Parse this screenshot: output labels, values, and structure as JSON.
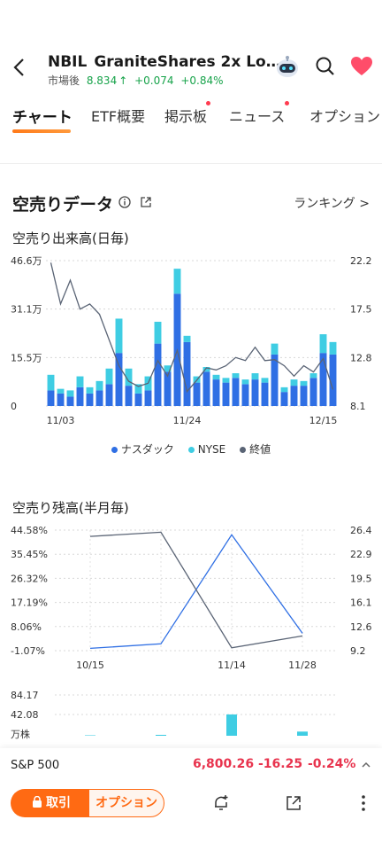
{
  "header": {
    "ticker": "NBIL",
    "name": "GraniteShares 2x Lo…",
    "session_label": "市場後",
    "price": "8.834",
    "arrow": "↑",
    "change": "+0.074",
    "change_pct": "+0.84%"
  },
  "tabs": [
    {
      "label": "チャート",
      "active": true
    },
    {
      "label": "ETF概要"
    },
    {
      "label": "掲示板",
      "badge": true
    },
    {
      "label": "ニュース",
      "badge": true
    },
    {
      "label": "オプション"
    }
  ],
  "short_section": {
    "title": "空売りデータ",
    "ranking": "ランキング",
    "ranking_chevron": ">"
  },
  "legend": [
    {
      "label": "ナスダック",
      "color": "#2f6fe4"
    },
    {
      "label": "NYSE",
      "color": "#3fcde3"
    },
    {
      "label": "終値",
      "color": "#5a6475"
    }
  ],
  "chart_data": [
    {
      "type": "bar",
      "title": "空売り出来高(日毎)",
      "y_ticks_left": [
        "46.6万",
        "31.1万",
        "15.5万",
        "0"
      ],
      "y_ticks_right": [
        "22.2",
        "17.5",
        "12.8",
        "8.1"
      ],
      "x_ticks": [
        "11/03",
        "11/24",
        "12/15"
      ],
      "ylim": [
        0,
        466000
      ],
      "y2lim": [
        8.1,
        22.2
      ],
      "series": [
        {
          "name": "ナスダック",
          "values": [
            50000,
            40000,
            30000,
            60000,
            40000,
            50000,
            70000,
            170000,
            65000,
            40000,
            50000,
            200000,
            110000,
            360000,
            205000,
            75000,
            110000,
            85000,
            75000,
            90000,
            70000,
            85000,
            75000,
            165000,
            45000,
            65000,
            65000,
            90000,
            170000,
            165000
          ]
        },
        {
          "name": "NYSE",
          "values": [
            50000,
            15000,
            20000,
            35000,
            20000,
            30000,
            50000,
            110000,
            55000,
            30000,
            45000,
            70000,
            20000,
            80000,
            20000,
            20000,
            15000,
            15000,
            15000,
            15000,
            15000,
            20000,
            15000,
            35000,
            15000,
            20000,
            15000,
            15000,
            60000,
            40000
          ]
        },
        {
          "name": "終値",
          "values": [
            22.0,
            18.0,
            20.3,
            17.5,
            18.0,
            17.0,
            14.5,
            12.0,
            10.5,
            10.0,
            10.3,
            12.5,
            11.0,
            13.5,
            9.5,
            10.6,
            11.8,
            11.6,
            12.0,
            12.8,
            12.5,
            13.8,
            12.5,
            12.6,
            12.0,
            11.0,
            12.0,
            11.4,
            12.7,
            9.7
          ]
        }
      ]
    },
    {
      "type": "line",
      "title": "空売り残高(半月毎)",
      "y_ticks_left": [
        "44.58%",
        "35.45%",
        "26.32%",
        "17.19%",
        "8.06%",
        "-1.07%"
      ],
      "y_ticks_right": [
        "26.4",
        "22.9",
        "19.5",
        "16.1",
        "12.6",
        "9.2"
      ],
      "x_ticks": [
        "10/15",
        "11/14",
        "11/28"
      ],
      "ylim": [
        -1.07,
        44.58
      ],
      "y2lim": [
        9.2,
        26.4
      ],
      "x": [
        "10/15",
        "10/31",
        "11/14",
        "11/28"
      ],
      "series": [
        {
          "name": "空売り比率",
          "values": [
            -0.2,
            1.5,
            42.8,
            5.5
          ]
        },
        {
          "name": "終値",
          "values": [
            25.5,
            26.1,
            9.6,
            11.3
          ]
        }
      ]
    },
    {
      "type": "bar",
      "y_ticks_left": [
        "84.17",
        "42.08"
      ],
      "unit": "万株",
      "ylim": [
        0,
        84.17
      ],
      "x": [
        "10/15",
        "10/31",
        "11/14",
        "11/28"
      ],
      "series": [
        {
          "name": "",
          "values": [
            1.0,
            2.0,
            46.0,
            9.0
          ]
        }
      ]
    }
  ],
  "index_bar": {
    "name": "S&P 500",
    "value": "6,800.26",
    "change": "-16.25",
    "change_pct": "-0.24%"
  },
  "actions": {
    "trade_label": "取引",
    "option_label": "オプション"
  },
  "colors": {
    "nasdaq": "#2f6fe4",
    "nyse": "#3fcde3",
    "close": "#5a6475",
    "accent": "#ff6a13",
    "up": "#17a34a",
    "down": "#e8344e"
  }
}
